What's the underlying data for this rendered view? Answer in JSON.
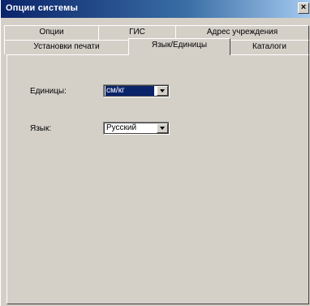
{
  "window": {
    "title": "Опции системы",
    "close_glyph": "×"
  },
  "tabs": {
    "row_back": [
      {
        "label": "Опции"
      },
      {
        "label": "ГИС"
      },
      {
        "label": "Адрес учреждения"
      }
    ],
    "row_front": [
      {
        "label": "Установки печати"
      },
      {
        "label": "Язык/Единицы",
        "active": true
      },
      {
        "label": "Каталоги"
      }
    ]
  },
  "form": {
    "units": {
      "label": "Единицы:",
      "value": "см/кг"
    },
    "language": {
      "label": "Язык:",
      "value": "Русский"
    }
  }
}
